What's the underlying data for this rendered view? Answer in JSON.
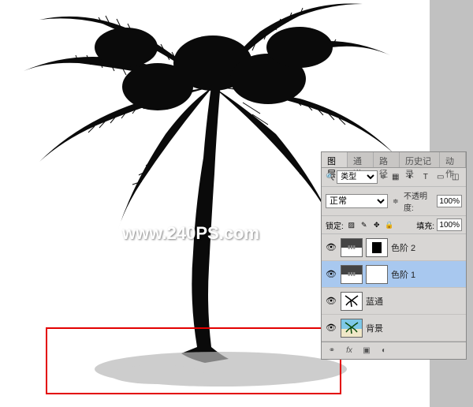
{
  "watermark": "www.240PS.com",
  "panel": {
    "tabs": [
      "图层",
      "通道",
      "路径",
      "历史记录",
      "动作"
    ],
    "active_tab": 0,
    "filter_label": "类型",
    "blend_mode": "正常",
    "opacity_label": "不透明度:",
    "opacity_value": "100%",
    "lock_label": "锁定:",
    "fill_label": "填充:",
    "fill_value": "100%"
  },
  "layers": [
    {
      "name": "色阶 2",
      "visible": true,
      "selected": false,
      "type": "adjustment",
      "mask": "black"
    },
    {
      "name": "色阶 1",
      "visible": true,
      "selected": true,
      "type": "adjustment",
      "mask": "white"
    },
    {
      "name": "蓝通",
      "visible": true,
      "selected": false,
      "type": "bitmap-bw"
    },
    {
      "name": "背景",
      "visible": true,
      "selected": false,
      "type": "bitmap-color"
    }
  ]
}
